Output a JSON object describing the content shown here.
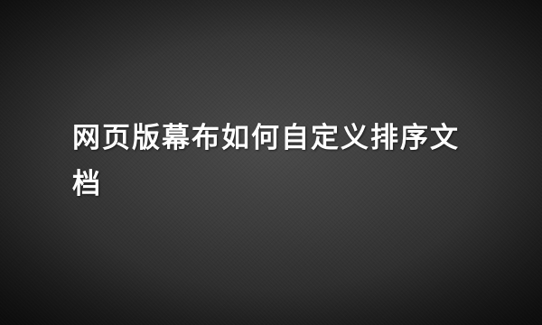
{
  "banner": {
    "title": "网页版幕布如何自定义排序文档",
    "background_color": "#3c3c3c",
    "text_color": "#ffffff"
  }
}
